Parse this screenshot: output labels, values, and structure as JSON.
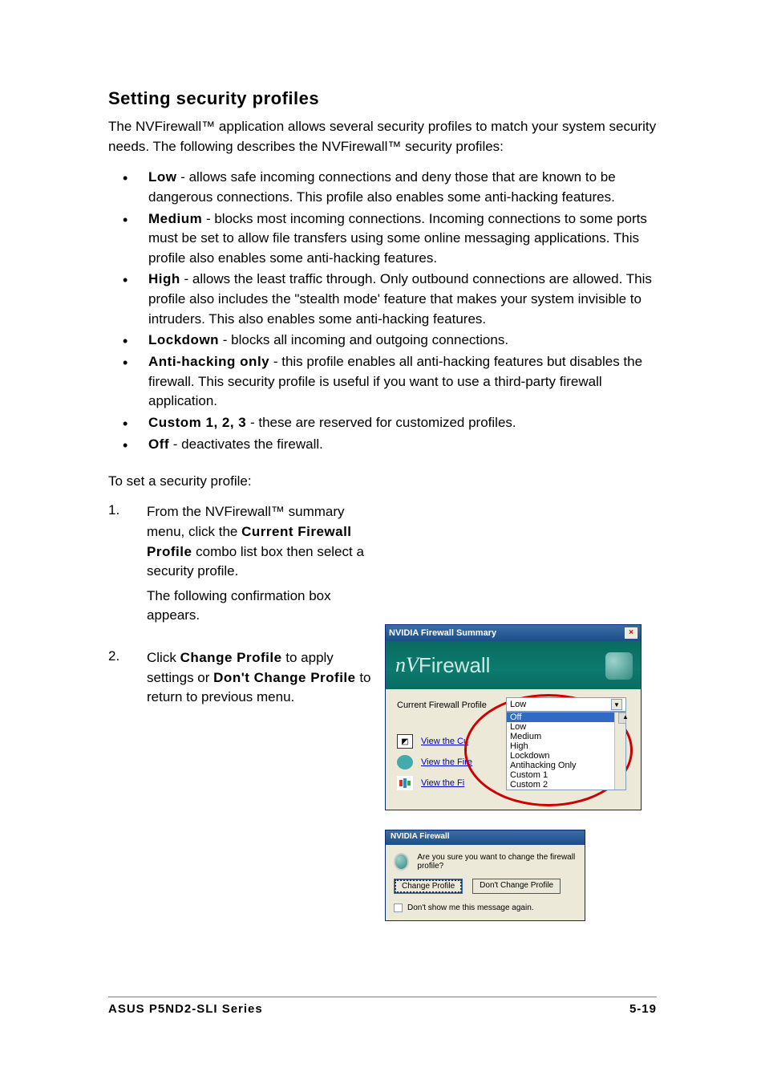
{
  "heading": "Setting security profiles",
  "intro": "The NVFirewall™ application allows several security profiles to match your system security needs. The following describes the NVFirewall™ security profiles:",
  "profiles": [
    {
      "term": "Low",
      "desc": " - allows safe incoming connections and deny those that are known to be dangerous connections. This profile also enables some anti-hacking features."
    },
    {
      "term": "Medium",
      "desc": " - blocks most incoming connections. Incoming connections to some ports must be set to allow file transfers using some online messaging applications. This profile also enables some anti-hacking features."
    },
    {
      "term": "High",
      "desc": " - allows the least traffic through. Only outbound connections are allowed. This profile also includes the \"stealth mode' feature that makes your system invisible to intruders. This also enables some anti-hacking features."
    },
    {
      "term": "Lockdown",
      "desc": " - blocks all incoming and outgoing connections."
    },
    {
      "term": "Anti-hacking only",
      "desc": " - this profile enables all anti-hacking features but disables the firewall. This security profile is useful if you want to use a third-party firewall application."
    },
    {
      "term": "Custom 1, 2, 3",
      "desc": " - these are reserved for customized profiles."
    },
    {
      "term": "Off",
      "desc": " - deactivates the firewall."
    }
  ],
  "steps_intro": "To set a security profile:",
  "steps": [
    {
      "num": "1.",
      "lines": [
        "From the NVFirewall™ summary menu, click the <b>Current Firewall Profile</b> combo list box then select a security profile.",
        "The following confirmation box appears."
      ]
    },
    {
      "num": "2.",
      "lines": [
        "Click <b>Change Profile</b> to apply settings or <b>Don't Change Profile</b> to return to previous menu."
      ]
    }
  ],
  "summary_window": {
    "title": "NVIDIA Firewall Summary",
    "banner_prefix": "nV",
    "banner_text": "Firewall",
    "label": "Current Firewall Profile",
    "selected": "Low",
    "options": [
      "Off",
      "Low",
      "Medium",
      "High",
      "Lockdown",
      "Antihacking Only",
      "Custom 1",
      "Custom 2"
    ],
    "links": [
      "View the Cu",
      "View the Fire",
      "View the Fi"
    ]
  },
  "dialog": {
    "title": "NVIDIA Firewall",
    "message": "Are you sure you want to change the firewall profile?",
    "btn_change": "Change Profile",
    "btn_dont": "Don't Change Profile",
    "checkbox": "Don't show me this message again."
  },
  "footer": {
    "left": "ASUS P5ND2-SLI Series",
    "right": "5-19"
  }
}
